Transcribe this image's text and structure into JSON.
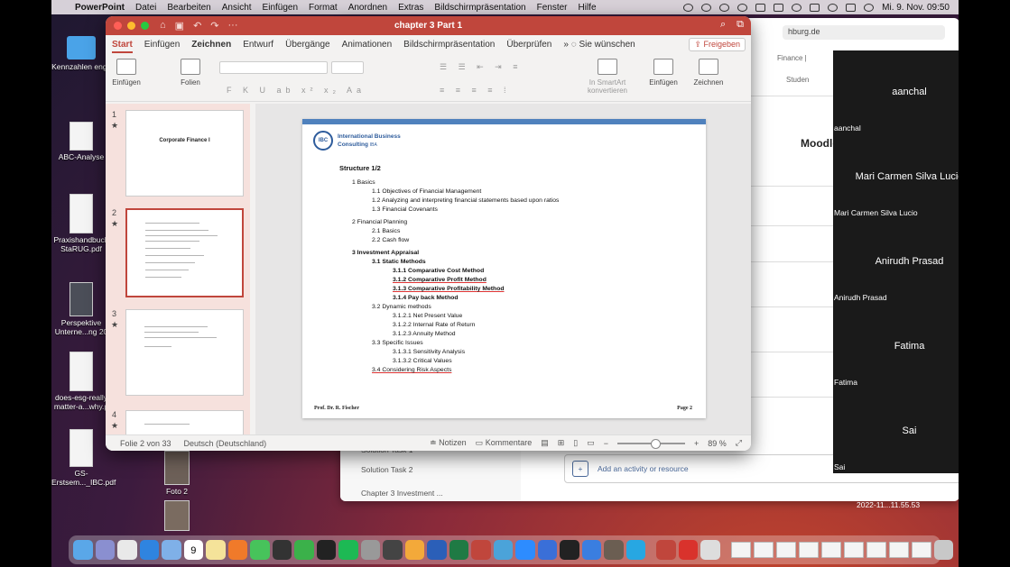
{
  "menubar": {
    "app": "PowerPoint",
    "items": [
      "Datei",
      "Bearbeiten",
      "Ansicht",
      "Einfügen",
      "Format",
      "Anordnen",
      "Extras",
      "Bildschirmpräsentation",
      "Fenster",
      "Hilfe"
    ],
    "clock": "Mi. 9. Nov.  09:50"
  },
  "desktop": {
    "icons": [
      "Kennzahlen engl.",
      "ABC-Analyse",
      "Praxishandbuch StaRUG.pdf",
      "Perspektive Unterne...ng 20",
      "does-esg-really matter-a...why.p",
      "GS-Erstsem..._IBC.pdf",
      "Foto 2"
    ],
    "screenshot_label": "2022-11...11.55.53"
  },
  "browser": {
    "url": "hburg.de",
    "moodle": "Moodle",
    "frag_finance": "Finance |",
    "frag_student": "Studen",
    "sidebar": [
      "Solution Task 1",
      "Solution Task 2",
      "Chapter 3 Investment ..."
    ],
    "add_activity": "Add an activity or resource"
  },
  "ppt": {
    "doc_title": "chapter 3 Part 1",
    "tabs": [
      "Start",
      "Einfügen",
      "Zeichnen",
      "Entwurf",
      "Übergänge",
      "Animationen",
      "Bildschirmpräsentation",
      "Überprüfen"
    ],
    "tell_me": "Sie wünschen",
    "share": "Freigeben",
    "ribbon": {
      "paste": "Einfügen",
      "slides": "Folien",
      "smartart": "In SmartArt konvertieren",
      "insert": "Einfügen",
      "draw": "Zeichnen"
    },
    "thumbs": {
      "nums": [
        "1",
        "2",
        "3",
        "4"
      ],
      "slide1_title": "Corporate Finance I"
    },
    "slide": {
      "logo_line1": "International Business",
      "logo_line2": "Consulting",
      "logo_suffix": "IBA",
      "logo_mark": "IBC",
      "title": "Structure 1/2",
      "outline": [
        "1    Basics",
        "1.1  Objectives of Financial Management",
        "1.2  Analyzing and interpreting financial statements based upon ratios",
        "1.3  Financial Covenants",
        "2    Financial Planning",
        "2.1  Basics",
        "2.2  Cash flow",
        "3    Investment Appraisal",
        "3.1  Static Methods",
        "3.1.1   Comparative Cost Method",
        "3.1.2   Comparative Profit Method",
        "3.1.3   Comparative Profitability Method",
        "3.1.4   Pay back Method",
        "3.2  Dynamic methods",
        "3.1.2.1    Net Present Value",
        "3.1.2.2    Internal Rate of Return",
        "3.1.2.3    Annuity Method",
        "3.3  Specific Issues",
        "3.1.3.1    Sensitivity Analysis",
        "3.1.3.2    Critical Values",
        "3.4  Considering Risk Aspects"
      ],
      "footer_left": "Prof. Dr. R. Fischer",
      "footer_right": "Page 2"
    },
    "status": {
      "slide_pos": "Folie 2 von 33",
      "language": "Deutsch (Deutschland)",
      "notes": "Notizen",
      "comments": "Kommentare",
      "zoom": "89 %"
    }
  },
  "participants": [
    {
      "name": "aanchal",
      "label": "aanchal"
    },
    {
      "name": "Mari Carmen Silva Lucio",
      "label": "Mari Carmen Silva Lucio"
    },
    {
      "name": "Anirudh Prasad",
      "label": "Anirudh Prasad"
    },
    {
      "name": "Fatima",
      "label": "Fatima"
    },
    {
      "name": "Sai",
      "label": "Sai"
    }
  ],
  "dock": {
    "calendar_day": "9",
    "calendar_month": "NOV"
  }
}
